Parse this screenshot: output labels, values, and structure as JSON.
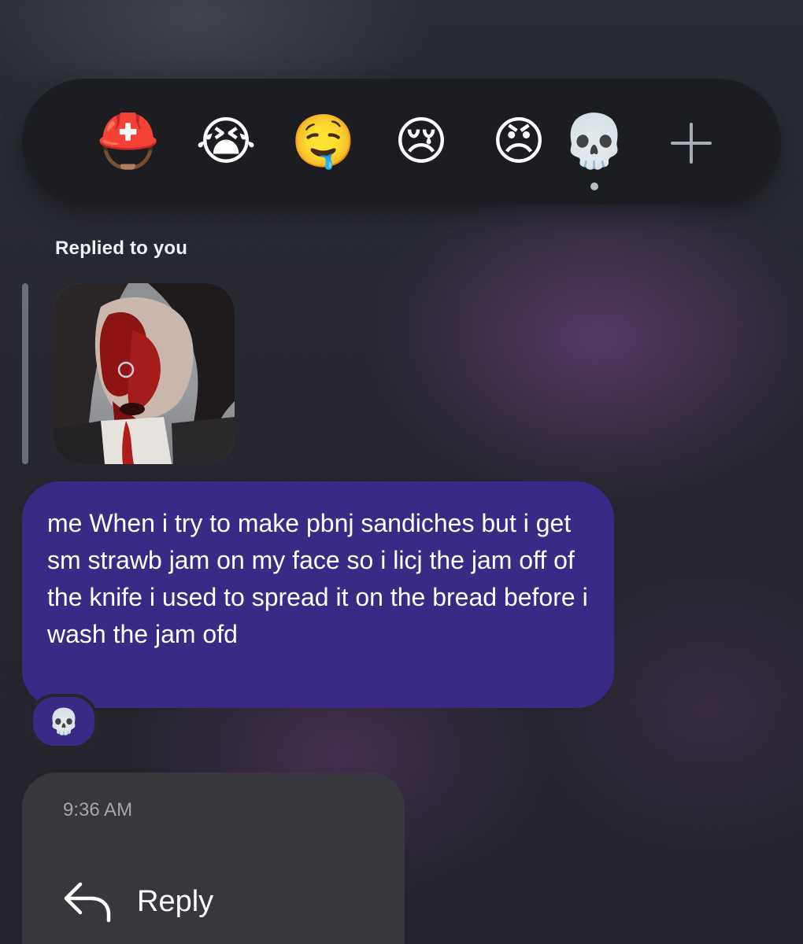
{
  "reaction_bar": {
    "reactions": [
      {
        "emoji": "⛑️",
        "name": "rescue-worker-helmet"
      },
      {
        "emoji": "😭",
        "name": "loudly-crying-face"
      },
      {
        "emoji": "🤤",
        "name": "drooling-face"
      },
      {
        "emoji": "😢",
        "name": "crying-face"
      },
      {
        "emoji": "😠",
        "name": "angry-face"
      },
      {
        "emoji": "💀",
        "name": "skull"
      }
    ],
    "selected": "skull",
    "more_icon": "plus-icon"
  },
  "reply_context": {
    "label": "Replied to you"
  },
  "message": {
    "text": "me When i try to make pbnj sandiches but i get sm strawb jam on my face so i licj the jam off of the knife i used to spread it on the bread before i wash the jam ofd",
    "bubble_color": "#3a2a86",
    "reaction": "💀"
  },
  "context_menu": {
    "timestamp": "9:36 AM",
    "reply_label": "Reply"
  }
}
